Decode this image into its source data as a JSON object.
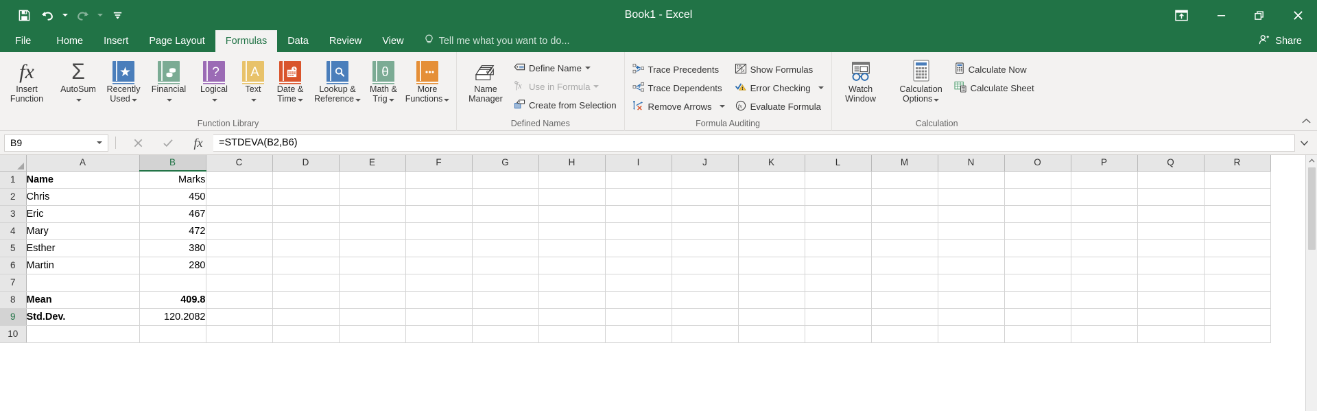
{
  "titlebar": {
    "title": "Book1 - Excel",
    "qat": [
      {
        "name": "save-button",
        "icon": "save-icon"
      },
      {
        "name": "undo-button",
        "icon": "undo-icon"
      },
      {
        "name": "redo-button",
        "icon": "redo-icon"
      },
      {
        "name": "customize-quick-access-toolbar-button",
        "icon": "chevron-down-icon"
      }
    ],
    "window": {
      "ribbon_display_options": "ribbon-display-options-icon",
      "minimize": "minimize-icon",
      "restore": "restore-icon",
      "close": "close-icon"
    }
  },
  "tabs": [
    {
      "label": "File",
      "active": false
    },
    {
      "label": "Home",
      "active": false
    },
    {
      "label": "Insert",
      "active": false
    },
    {
      "label": "Page Layout",
      "active": false
    },
    {
      "label": "Formulas",
      "active": true
    },
    {
      "label": "Data",
      "active": false
    },
    {
      "label": "Review",
      "active": false
    },
    {
      "label": "View",
      "active": false
    }
  ],
  "tellme": "Tell me what you want to do...",
  "share": "Share",
  "ribbon": {
    "groups": [
      {
        "label": "Function Library",
        "big_buttons": [
          {
            "label": "Insert\nFunction",
            "icon": "insert-function-icon",
            "symbol": "fx",
            "color": "none",
            "dropdown": false
          },
          {
            "label": "AutoSum",
            "icon": "autosum-icon",
            "symbol": "Σ",
            "color": "none",
            "dropdown": true
          },
          {
            "label": "Recently\nUsed",
            "icon": "recently-used-icon",
            "symbol": "★",
            "color": "#4a7ebb",
            "dropdown": true
          },
          {
            "label": "Financial",
            "icon": "financial-icon",
            "symbol": "◕",
            "color": "#7bab94",
            "dropdown": true
          },
          {
            "label": "Logical",
            "icon": "logical-icon",
            "symbol": "?",
            "color": "#9b6bb5",
            "dropdown": true
          },
          {
            "label": "Text",
            "icon": "text-icon",
            "symbol": "A",
            "color": "#e8c26a",
            "dropdown": true
          },
          {
            "label": "Date &\nTime",
            "icon": "date-time-icon",
            "symbol": "▦",
            "color": "#d9542b",
            "dropdown": true
          },
          {
            "label": "Lookup &\nReference",
            "icon": "lookup-reference-icon",
            "symbol": "⚲",
            "color": "#4a7ebb",
            "dropdown": true
          },
          {
            "label": "Math &\nTrig",
            "icon": "math-trig-icon",
            "symbol": "θ",
            "color": "#7bab94",
            "dropdown": true
          },
          {
            "label": "More\nFunctions",
            "icon": "more-functions-icon",
            "symbol": "⋯",
            "color": "#e58f37",
            "dropdown": true
          }
        ]
      },
      {
        "label": "Defined Names",
        "big_buttons": [
          {
            "label": "Name\nManager",
            "icon": "name-manager-icon",
            "symbol": "",
            "color": "none",
            "dropdown": false
          }
        ],
        "small_buttons": [
          {
            "label": "Define Name",
            "icon": "define-name-icon",
            "dropdown": true,
            "disabled": false
          },
          {
            "label": "Use in Formula",
            "icon": "use-in-formula-icon",
            "dropdown": true,
            "disabled": true
          },
          {
            "label": "Create from Selection",
            "icon": "create-from-selection-icon",
            "dropdown": false,
            "disabled": false
          }
        ]
      },
      {
        "label": "Formula Auditing",
        "small_columns": [
          [
            {
              "label": "Trace Precedents",
              "icon": "trace-precedents-icon",
              "dropdown": false,
              "disabled": false
            },
            {
              "label": "Trace Dependents",
              "icon": "trace-dependents-icon",
              "dropdown": false,
              "disabled": false
            },
            {
              "label": "Remove Arrows",
              "icon": "remove-arrows-icon",
              "dropdown": true,
              "disabled": false
            }
          ],
          [
            {
              "label": "Show Formulas",
              "icon": "show-formulas-icon",
              "dropdown": false,
              "disabled": false
            },
            {
              "label": "Error Checking",
              "icon": "error-checking-icon",
              "dropdown": true,
              "disabled": false
            },
            {
              "label": "Evaluate Formula",
              "icon": "evaluate-formula-icon",
              "dropdown": false,
              "disabled": false
            }
          ]
        ]
      },
      {
        "label": "Calculation",
        "big_buttons": [
          {
            "label": "Watch\nWindow",
            "icon": "watch-window-icon",
            "symbol": "",
            "color": "none",
            "dropdown": false
          },
          {
            "label": "Calculation\nOptions",
            "icon": "calculation-options-icon",
            "symbol": "",
            "color": "none",
            "dropdown": true
          }
        ],
        "small_buttons": [
          {
            "label": "Calculate Now",
            "icon": "calculate-now-icon",
            "dropdown": false,
            "disabled": false
          },
          {
            "label": "Calculate Sheet",
            "icon": "calculate-sheet-icon",
            "dropdown": false,
            "disabled": false
          }
        ]
      }
    ]
  },
  "formula_bar": {
    "name_box": "B9",
    "cancel_icon": "cancel-icon",
    "enter_icon": "confirm-icon",
    "fx_icon": "insert-function-icon",
    "formula": "=STDEVA(B2,B6)",
    "expand_icon": "chevron-down-icon"
  },
  "grid": {
    "column_headers": [
      "A",
      "B",
      "C",
      "D",
      "E",
      "F",
      "G",
      "H",
      "I",
      "J",
      "K",
      "L",
      "M",
      "N",
      "O",
      "P",
      "Q",
      "R"
    ],
    "selected_column": "B",
    "selected_row": "9",
    "selected_cell": "B9",
    "row_headers": [
      "1",
      "2",
      "3",
      "4",
      "5",
      "6",
      "7",
      "8",
      "9",
      "10"
    ],
    "rows": [
      {
        "num": "1",
        "a": "Name",
        "b": "Marks",
        "bold_a": true,
        "bold_b": false
      },
      {
        "num": "2",
        "a": "Chris",
        "b": "450",
        "bold_a": false,
        "bold_b": false
      },
      {
        "num": "3",
        "a": "Eric",
        "b": "467",
        "bold_a": false,
        "bold_b": false
      },
      {
        "num": "4",
        "a": "Mary",
        "b": "472",
        "bold_a": false,
        "bold_b": false
      },
      {
        "num": "5",
        "a": "Esther",
        "b": "380",
        "bold_a": false,
        "bold_b": false
      },
      {
        "num": "6",
        "a": "Martin",
        "b": "280",
        "bold_a": false,
        "bold_b": false
      },
      {
        "num": "7",
        "a": "",
        "b": "",
        "bold_a": false,
        "bold_b": false
      },
      {
        "num": "8",
        "a": "Mean",
        "b": "409.8",
        "bold_a": true,
        "bold_b": true
      },
      {
        "num": "9",
        "a": "Std.Dev.",
        "b": "120.2082",
        "bold_a": true,
        "bold_b": false
      },
      {
        "num": "10",
        "a": "",
        "b": "",
        "bold_a": false,
        "bold_b": false
      }
    ]
  },
  "colors": {
    "excel_green": "#217346",
    "ribbon_bg": "#f3f2f1",
    "selection_green": "#217346"
  }
}
